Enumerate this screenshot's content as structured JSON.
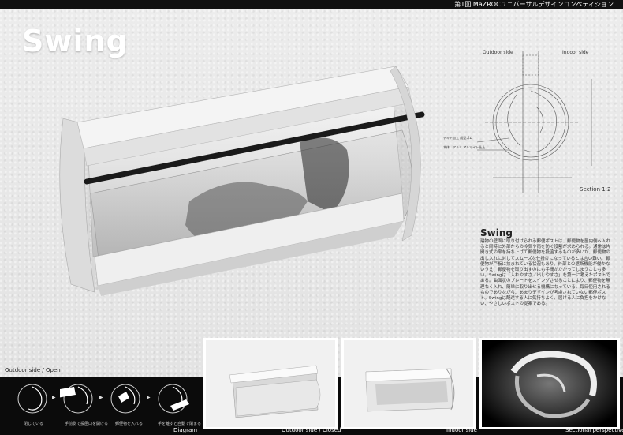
{
  "header": {
    "competition": "第1回 MaZROCユニバーサルデザインコンペティション"
  },
  "title": "Swing",
  "section": {
    "outdoor_label": "Outdoor side",
    "indoor_label": "Indoor side",
    "note1": "テキト加工 成型ゴム",
    "note2": "本体　アルミ アルマイト仕上",
    "caption": "Section  1:2"
  },
  "description": {
    "heading": "Swing",
    "body": "建物の壁面に取り付けられる郵便ポストは、郵便物を屋内側へ入れると同時に外部からの冷気や雨を防ぐ役割が求められる。通常は片開き式の扉を持ち上げて郵便物を投函するものが多いが、郵便物の出し入れに対してスムーズな仕掛けになっているとは言い難い。郵便物が戸板に挟まれている状況もあり、外部との遮断機能が働かないうえ、郵便物を取り出すのにも手間がかかってしまうことも多い。Swingは「入れやすさ／出しやすさ」を第一に考えたポストである。曲面状のプレートをスイングさせることにより、郵便物を無理なく入れ、簡単に取り出せる機構になっている。毎日使用されるものでありながら、あまりデザインが考慮されていない郵便ポスト。Swingは配達する人に気持ちよく、届ける人に負担をかけない、やさしいポストの提案である。"
  },
  "diagram": {
    "title": "Outdoor side / Open",
    "caption": "Diagram",
    "steps": [
      {
        "label": "閉じている"
      },
      {
        "label": "手前側で投函口を開ける"
      },
      {
        "label": "郵便物を入れる"
      },
      {
        "label": "手を離すと自動で閉まる"
      }
    ]
  },
  "panels": [
    {
      "caption": "Outdoor side / Closed"
    },
    {
      "caption": "Indoor side"
    },
    {
      "caption": "Sectional perspective"
    }
  ]
}
